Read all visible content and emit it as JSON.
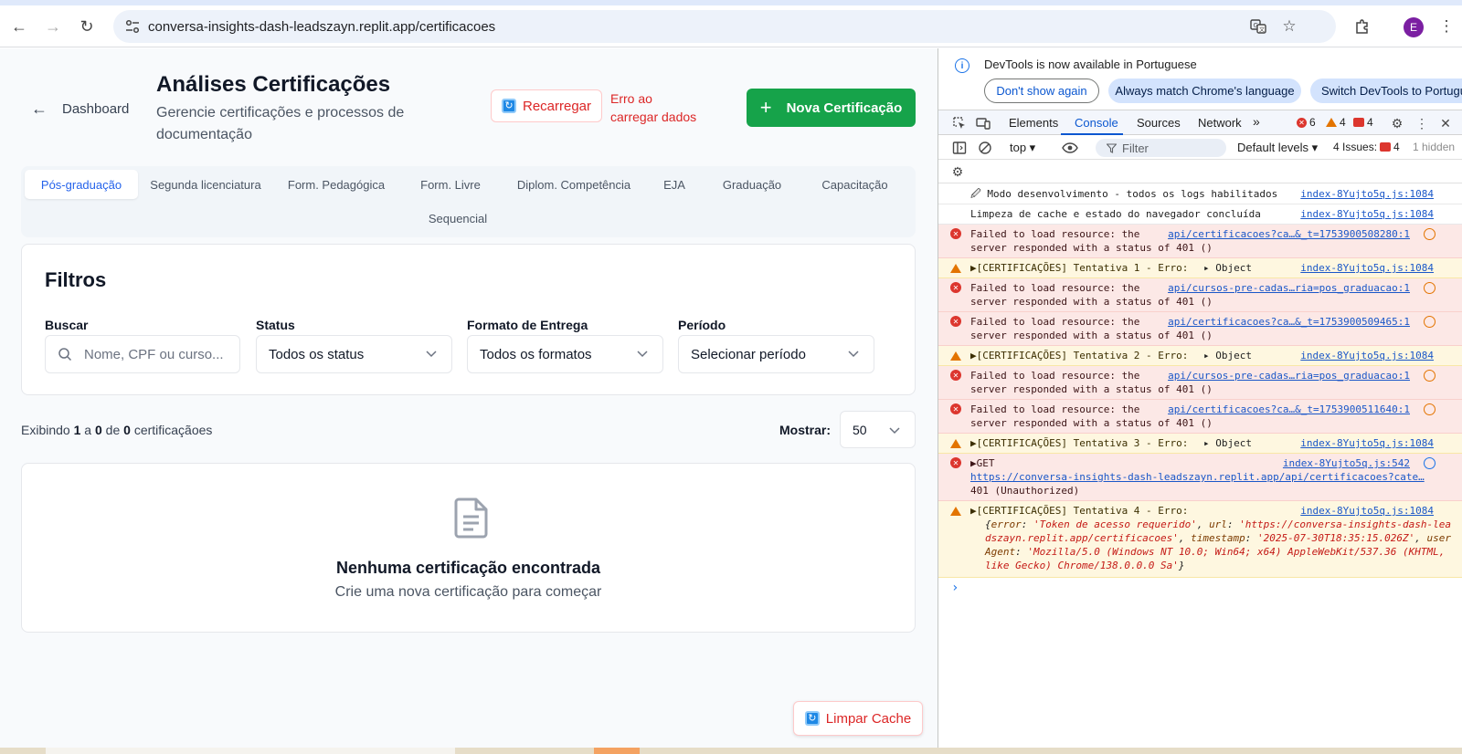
{
  "browser": {
    "url": "conversa-insights-dash-leadszayn.replit.app/certificacoes",
    "profile_initial": "E"
  },
  "header": {
    "back_label": "Dashboard",
    "title": "Análises Certificações",
    "subtitle": "Gerencie certificações e processos de documentação",
    "reload_label": "Recarregar",
    "error_text": "Erro ao carregar dados",
    "new_label": "Nova Certificação"
  },
  "tabs": [
    {
      "label": "Pós-graduação"
    },
    {
      "label": "Segunda licenciatura"
    },
    {
      "label": "Form. Pedagógica"
    },
    {
      "label": "Form. Livre"
    },
    {
      "label": "Diplom. Competência"
    },
    {
      "label": "EJA"
    },
    {
      "label": "Graduação"
    },
    {
      "label": "Capacitação"
    },
    {
      "label": "Sequencial"
    }
  ],
  "filters": {
    "title": "Filtros",
    "search": {
      "label": "Buscar",
      "placeholder": "Nome, CPF ou curso..."
    },
    "status": {
      "label": "Status",
      "value": "Todos os status"
    },
    "format": {
      "label": "Formato de Entrega",
      "value": "Todos os formatos"
    },
    "period": {
      "label": "Período",
      "value": "Selecionar período"
    }
  },
  "listing": {
    "prefix": "Exibindo",
    "from": "1",
    "a": "a",
    "to": "0",
    "de": "de",
    "total": "0",
    "suffix": "certificaçãoes",
    "show_label": "Mostrar:",
    "page_size": "50"
  },
  "empty": {
    "title": "Nenhuma certificação encontrada",
    "subtitle": "Crie uma nova certificação para começar"
  },
  "clear_cache_label": "Limpar Cache",
  "devtools": {
    "info_text": "DevTools is now available in Portuguese",
    "btn_dont_show": "Don't show again",
    "btn_match": "Always match Chrome's language",
    "btn_switch": "Switch DevTools to Portuguese",
    "tabs": [
      "Elements",
      "Console",
      "Sources",
      "Network"
    ],
    "errors_count": "6",
    "warnings_count": "4",
    "issues_badge_count": "4",
    "context": "top ▾",
    "filter_placeholder": "Filter",
    "levels": "Default levels ▾",
    "issues_label": "4 Issues:",
    "issues_count": "4",
    "hidden_label": "1 hidden",
    "messages": [
      {
        "type": "info",
        "text": "🖉 Modo desenvolvimento - todos os logs habilitados",
        "source": "index-8Yujto5q.js:1084"
      },
      {
        "type": "info",
        "text": "Limpeza de cache e estado do navegador concluída",
        "source": "index-8Yujto5q.js:1084"
      },
      {
        "type": "error",
        "line1": "Failed to load resource: the",
        "link": "api/certificacoes?ca…&_t=1753900508280:1",
        "line2": "server responded with a status of 401 ()"
      },
      {
        "type": "warn",
        "text": "▶[CERTIFICAÇÕES] Tentativa 1 - Erro:",
        "obj": "▸ Object",
        "source": "index-8Yujto5q.js:1084"
      },
      {
        "type": "error",
        "line1": "Failed to load resource: the",
        "link": "api/cursos-pre-cadas…ria=pos_graduacao:1",
        "line2": "server responded with a status of 401 ()"
      },
      {
        "type": "error",
        "line1": "Failed to load resource: the",
        "link": "api/certificacoes?ca…&_t=1753900509465:1",
        "line2": "server responded with a status of 401 ()"
      },
      {
        "type": "warn",
        "text": "▶[CERTIFICAÇÕES] Tentativa 2 - Erro:",
        "obj": "▸ Object",
        "source": "index-8Yujto5q.js:1084"
      },
      {
        "type": "error",
        "line1": "Failed to load resource: the",
        "link": "api/cursos-pre-cadas…ria=pos_graduacao:1",
        "line2": "server responded with a status of 401 ()"
      },
      {
        "type": "error",
        "line1": "Failed to load resource: the",
        "link": "api/certificacoes?ca…&_t=1753900511640:1",
        "line2": "server responded with a status of 401 ()"
      },
      {
        "type": "warn",
        "text": "▶[CERTIFICAÇÕES] Tentativa 3 - Erro:",
        "obj": "▸ Object",
        "source": "index-8Yujto5q.js:1084"
      },
      {
        "type": "get",
        "line1": "▶GET",
        "source": "index-8Yujto5q.js:542",
        "link": "https://conversa-insights-dash-leadszayn.replit.app/api/certificacoes?cate…",
        "line2": "401 (Unauthorized)"
      },
      {
        "type": "warn4",
        "text": "▶[CERTIFICAÇÕES] Tentativa 4 - Erro:",
        "source": "index-8Yujto5q.js:1084",
        "k_error": "error",
        "v_error": "'Token de acesso requerido'",
        "k_url": "url",
        "v_url": "'https://conversa-insights-dash-leadszayn.replit.app/certificacoes'",
        "k_ts": "timestamp",
        "v_ts": "'2025-07-30T18:35:15.026Z'",
        "k_ua": "userAgent",
        "v_ua": "'Mozilla/5.0 (Windows NT 10.0; Win64; x64) AppleWebKit/537.36 (KHTML, like Gecko) Chrome/138.0.0.0 Sa'"
      }
    ]
  }
}
